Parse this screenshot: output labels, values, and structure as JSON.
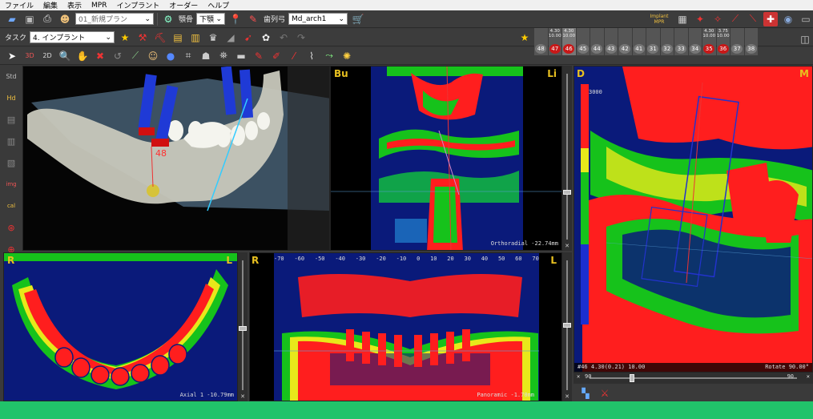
{
  "menu": [
    "ファイル",
    "編集",
    "表示",
    "MPR",
    "インプラント",
    "オーダー",
    "ヘルプ"
  ],
  "toolbar1": {
    "plan_name": "01_新規プラン",
    "jaw_label": "顎骨",
    "jaw_value": "下顎",
    "arch_label": "歯列弓",
    "arch_value": "Md_arch1",
    "implant_mpr": "Implant MPR"
  },
  "toolbar2": {
    "task_label": "タスク",
    "task_value": "4. インプラント"
  },
  "teeth": [
    {
      "num": "48",
      "l1": "",
      "l2": "",
      "implant": false,
      "current": false
    },
    {
      "num": "47",
      "l1": "4.30",
      "l2": "10.00",
      "implant": true,
      "current": false
    },
    {
      "num": "46",
      "l1": "4.30",
      "l2": "10.00",
      "implant": true,
      "current": true
    },
    {
      "num": "45",
      "l1": "",
      "l2": "",
      "implant": false,
      "current": false
    },
    {
      "num": "44",
      "l1": "",
      "l2": "",
      "implant": false,
      "current": false
    },
    {
      "num": "43",
      "l1": "",
      "l2": "",
      "implant": false,
      "current": false
    },
    {
      "num": "42",
      "l1": "",
      "l2": "",
      "implant": false,
      "current": false
    },
    {
      "num": "41",
      "l1": "",
      "l2": "",
      "implant": false,
      "current": false
    },
    {
      "num": "31",
      "l1": "",
      "l2": "",
      "implant": false,
      "current": false
    },
    {
      "num": "32",
      "l1": "",
      "l2": "",
      "implant": false,
      "current": false
    },
    {
      "num": "33",
      "l1": "",
      "l2": "",
      "implant": false,
      "current": false
    },
    {
      "num": "34",
      "l1": "",
      "l2": "",
      "implant": false,
      "current": false
    },
    {
      "num": "35",
      "l1": "4.30",
      "l2": "10.00",
      "implant": true,
      "current": false
    },
    {
      "num": "36",
      "l1": "3.75",
      "l2": "10.00",
      "implant": true,
      "current": false
    },
    {
      "num": "37",
      "l1": "",
      "l2": "",
      "implant": false,
      "current": false
    },
    {
      "num": "38",
      "l1": "",
      "l2": "",
      "implant": false,
      "current": false
    }
  ],
  "views": {
    "ortho": {
      "left": "Bu",
      "right": "Li",
      "caption": "Orthoradial -22.74mm"
    },
    "axial": {
      "left": "R",
      "right": "L",
      "caption": "Axial 1 -10.79mm"
    },
    "pano": {
      "left": "R",
      "right": "L",
      "caption": "Panoramic -1.70mm",
      "ruler": [
        "-70",
        "-60",
        "-50",
        "-40",
        "-30",
        "-20",
        "-10",
        "0",
        "10",
        "20",
        "30",
        "40",
        "50",
        "60",
        "70"
      ]
    },
    "cross": {
      "left": "D",
      "right": "M",
      "scale_top": "3000",
      "caption_left": "#46 4.30(0.21) 10.00",
      "caption_right": "Rotate 90.00°"
    },
    "hslider": {
      "left": "90",
      "right": "90"
    }
  },
  "colors": {
    "bone_red": "#ff1e1e",
    "bg_blue": "#0a1a7a",
    "green": "#16c21b",
    "yellow": "#e8e81a",
    "status_green": "#21c36a"
  }
}
